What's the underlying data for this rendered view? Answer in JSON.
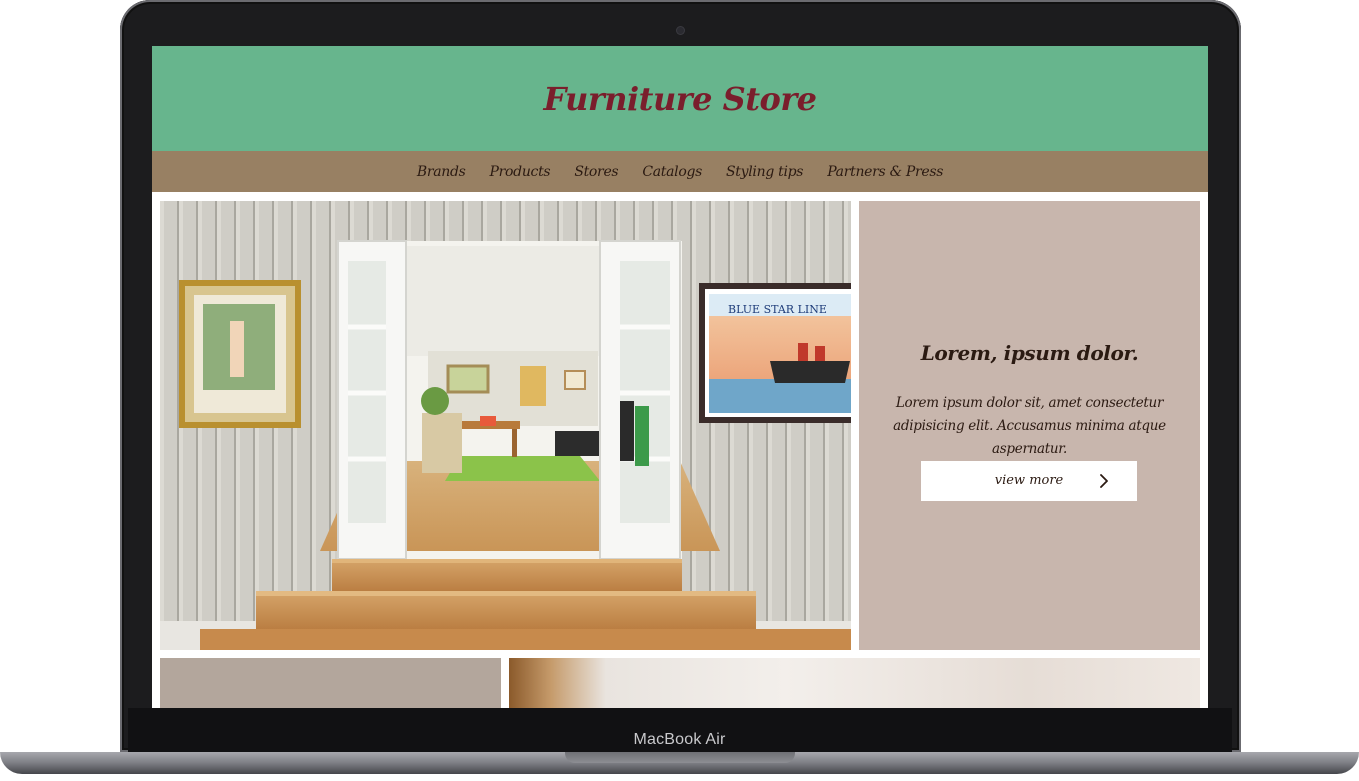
{
  "device": {
    "label": "MacBook Air"
  },
  "site": {
    "title": "Furniture Store",
    "nav": [
      {
        "label": "Brands"
      },
      {
        "label": "Products"
      },
      {
        "label": "Stores"
      },
      {
        "label": "Catalogs"
      },
      {
        "label": "Styling tips"
      },
      {
        "label": "Partners & Press"
      }
    ],
    "hero": {
      "heading": "Lorem, ipsum dolor.",
      "text": "Lorem ipsum dolor sit, amet consectetur adipisicing elit. Accusamus minima atque aspernatur.",
      "button_label": "view more"
    },
    "poster_caption": "BLUE STAR LINE"
  },
  "colors": {
    "header_bg": "#67b58d",
    "title_color": "#7a1e2c",
    "nav_bg": "#988063",
    "panel_bg": "#c8b6ad"
  },
  "icons": {
    "button_icon": "chevron-right-icon"
  }
}
